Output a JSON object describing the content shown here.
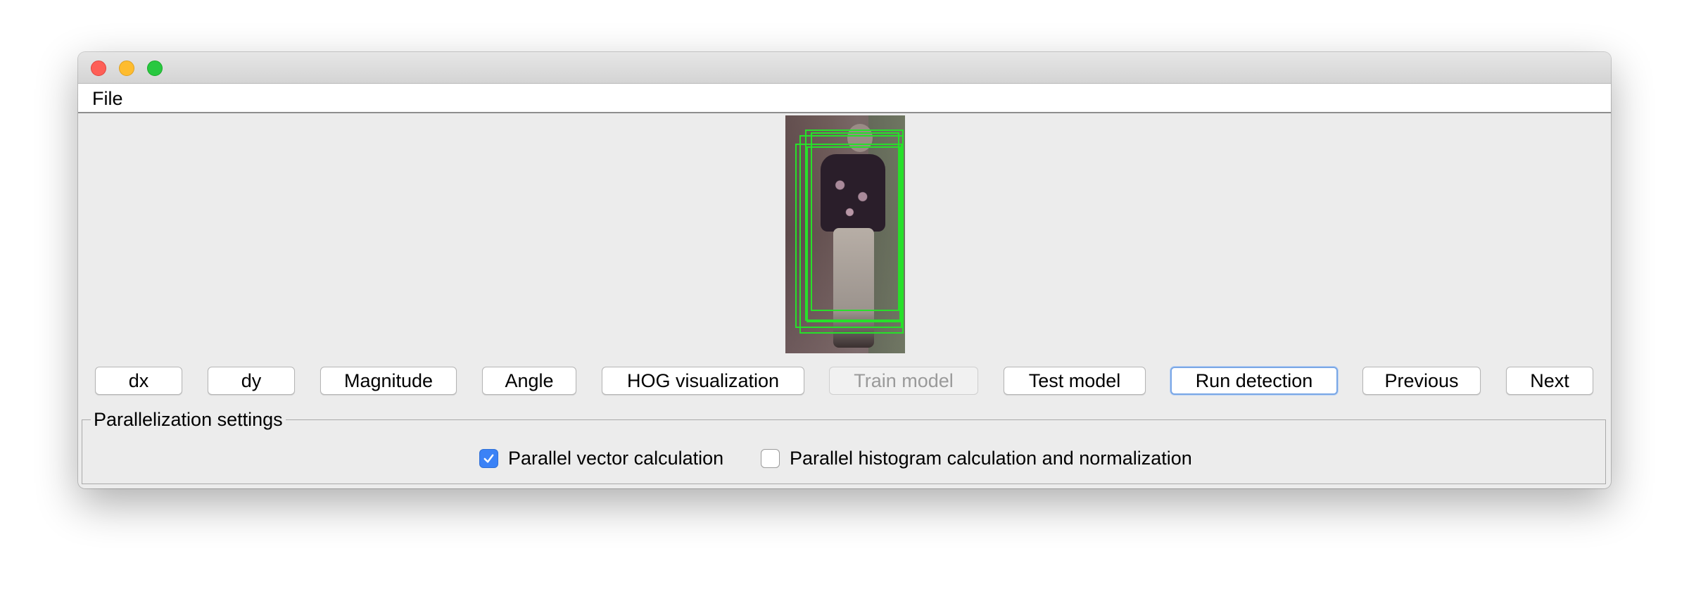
{
  "menubar": {
    "file_label": "File"
  },
  "toolbar": {
    "buttons": [
      {
        "label": "dx",
        "enabled": true
      },
      {
        "label": "dy",
        "enabled": true
      },
      {
        "label": "Magnitude",
        "enabled": true
      },
      {
        "label": "Angle",
        "enabled": true
      },
      {
        "label": "HOG visualization",
        "enabled": true
      },
      {
        "label": "Train model",
        "enabled": false
      },
      {
        "label": "Test model",
        "enabled": true
      },
      {
        "label": "Run detection",
        "enabled": true,
        "default": true
      },
      {
        "label": "Previous",
        "enabled": true
      },
      {
        "label": "Next",
        "enabled": true
      }
    ]
  },
  "parallelization": {
    "legend": "Parallelization settings",
    "vector_label": "Parallel vector calculation",
    "vector_checked": true,
    "histogram_label": "Parallel histogram calculation and normalization",
    "histogram_checked": false
  },
  "colors": {
    "detection_box": "#27e02a",
    "checkbox_accent": "#3b82f6",
    "default_button_ring": "#7aa7e6"
  }
}
